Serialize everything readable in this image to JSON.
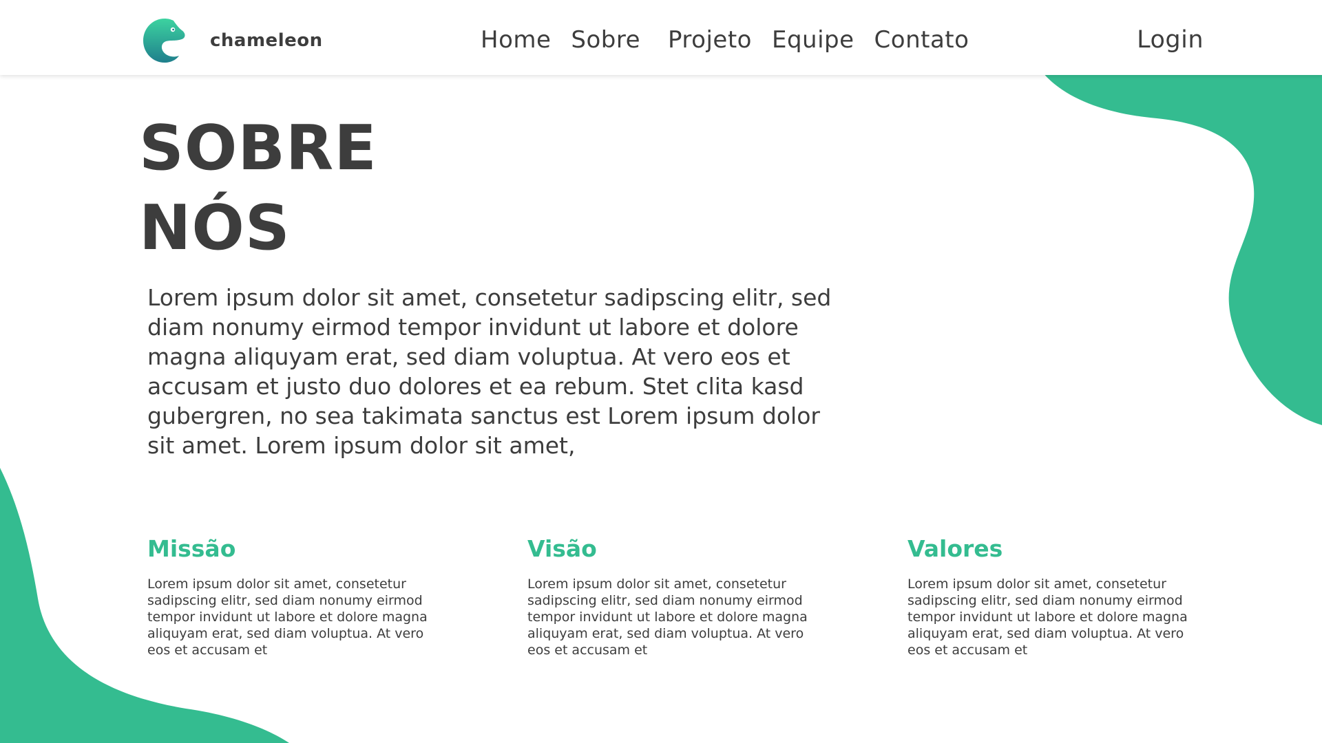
{
  "colors": {
    "accent": "#34bc90",
    "text": "#3d3d3d",
    "background": "#ffffff"
  },
  "brand": {
    "logo_icon": "chameleon-logo-icon",
    "name": "chameleon"
  },
  "nav": {
    "items": [
      {
        "label": "Home"
      },
      {
        "label": "Sobre"
      },
      {
        "label": "Projeto"
      },
      {
        "label": "Equipe"
      },
      {
        "label": "Contato"
      }
    ],
    "login_label": "Login"
  },
  "hero": {
    "title_line1": "SOBRE",
    "title_line2": "NÓS",
    "intro": "Lorem ipsum dolor sit amet, consetetur sadipscing elitr, sed diam nonumy eirmod tempor invidunt ut labore et dolore magna aliquyam erat, sed diam voluptua. At vero eos et accusam et justo duo dolores et ea rebum. Stet clita kasd gubergren, no sea takimata sanctus est Lorem ipsum dolor sit amet. Lorem ipsum dolor sit amet,"
  },
  "sections": [
    {
      "title": "Missão",
      "text": "Lorem ipsum dolor sit amet, consetetur sadipscing elitr, sed diam nonumy eirmod tempor invidunt ut labore et dolore magna aliquyam erat, sed diam voluptua. At vero eos et accusam et"
    },
    {
      "title": "Visão",
      "text": "Lorem ipsum dolor sit amet, consetetur sadipscing elitr, sed diam nonumy eirmod tempor invidunt ut labore et dolore magna aliquyam erat, sed diam voluptua. At vero eos et accusam et"
    },
    {
      "title": "Valores",
      "text": "Lorem ipsum dolor sit amet, consetetur sadipscing elitr, sed diam nonumy eirmod tempor invidunt ut labore et dolore magna aliquyam erat, sed diam voluptua. At vero eos et accusam et"
    }
  ]
}
